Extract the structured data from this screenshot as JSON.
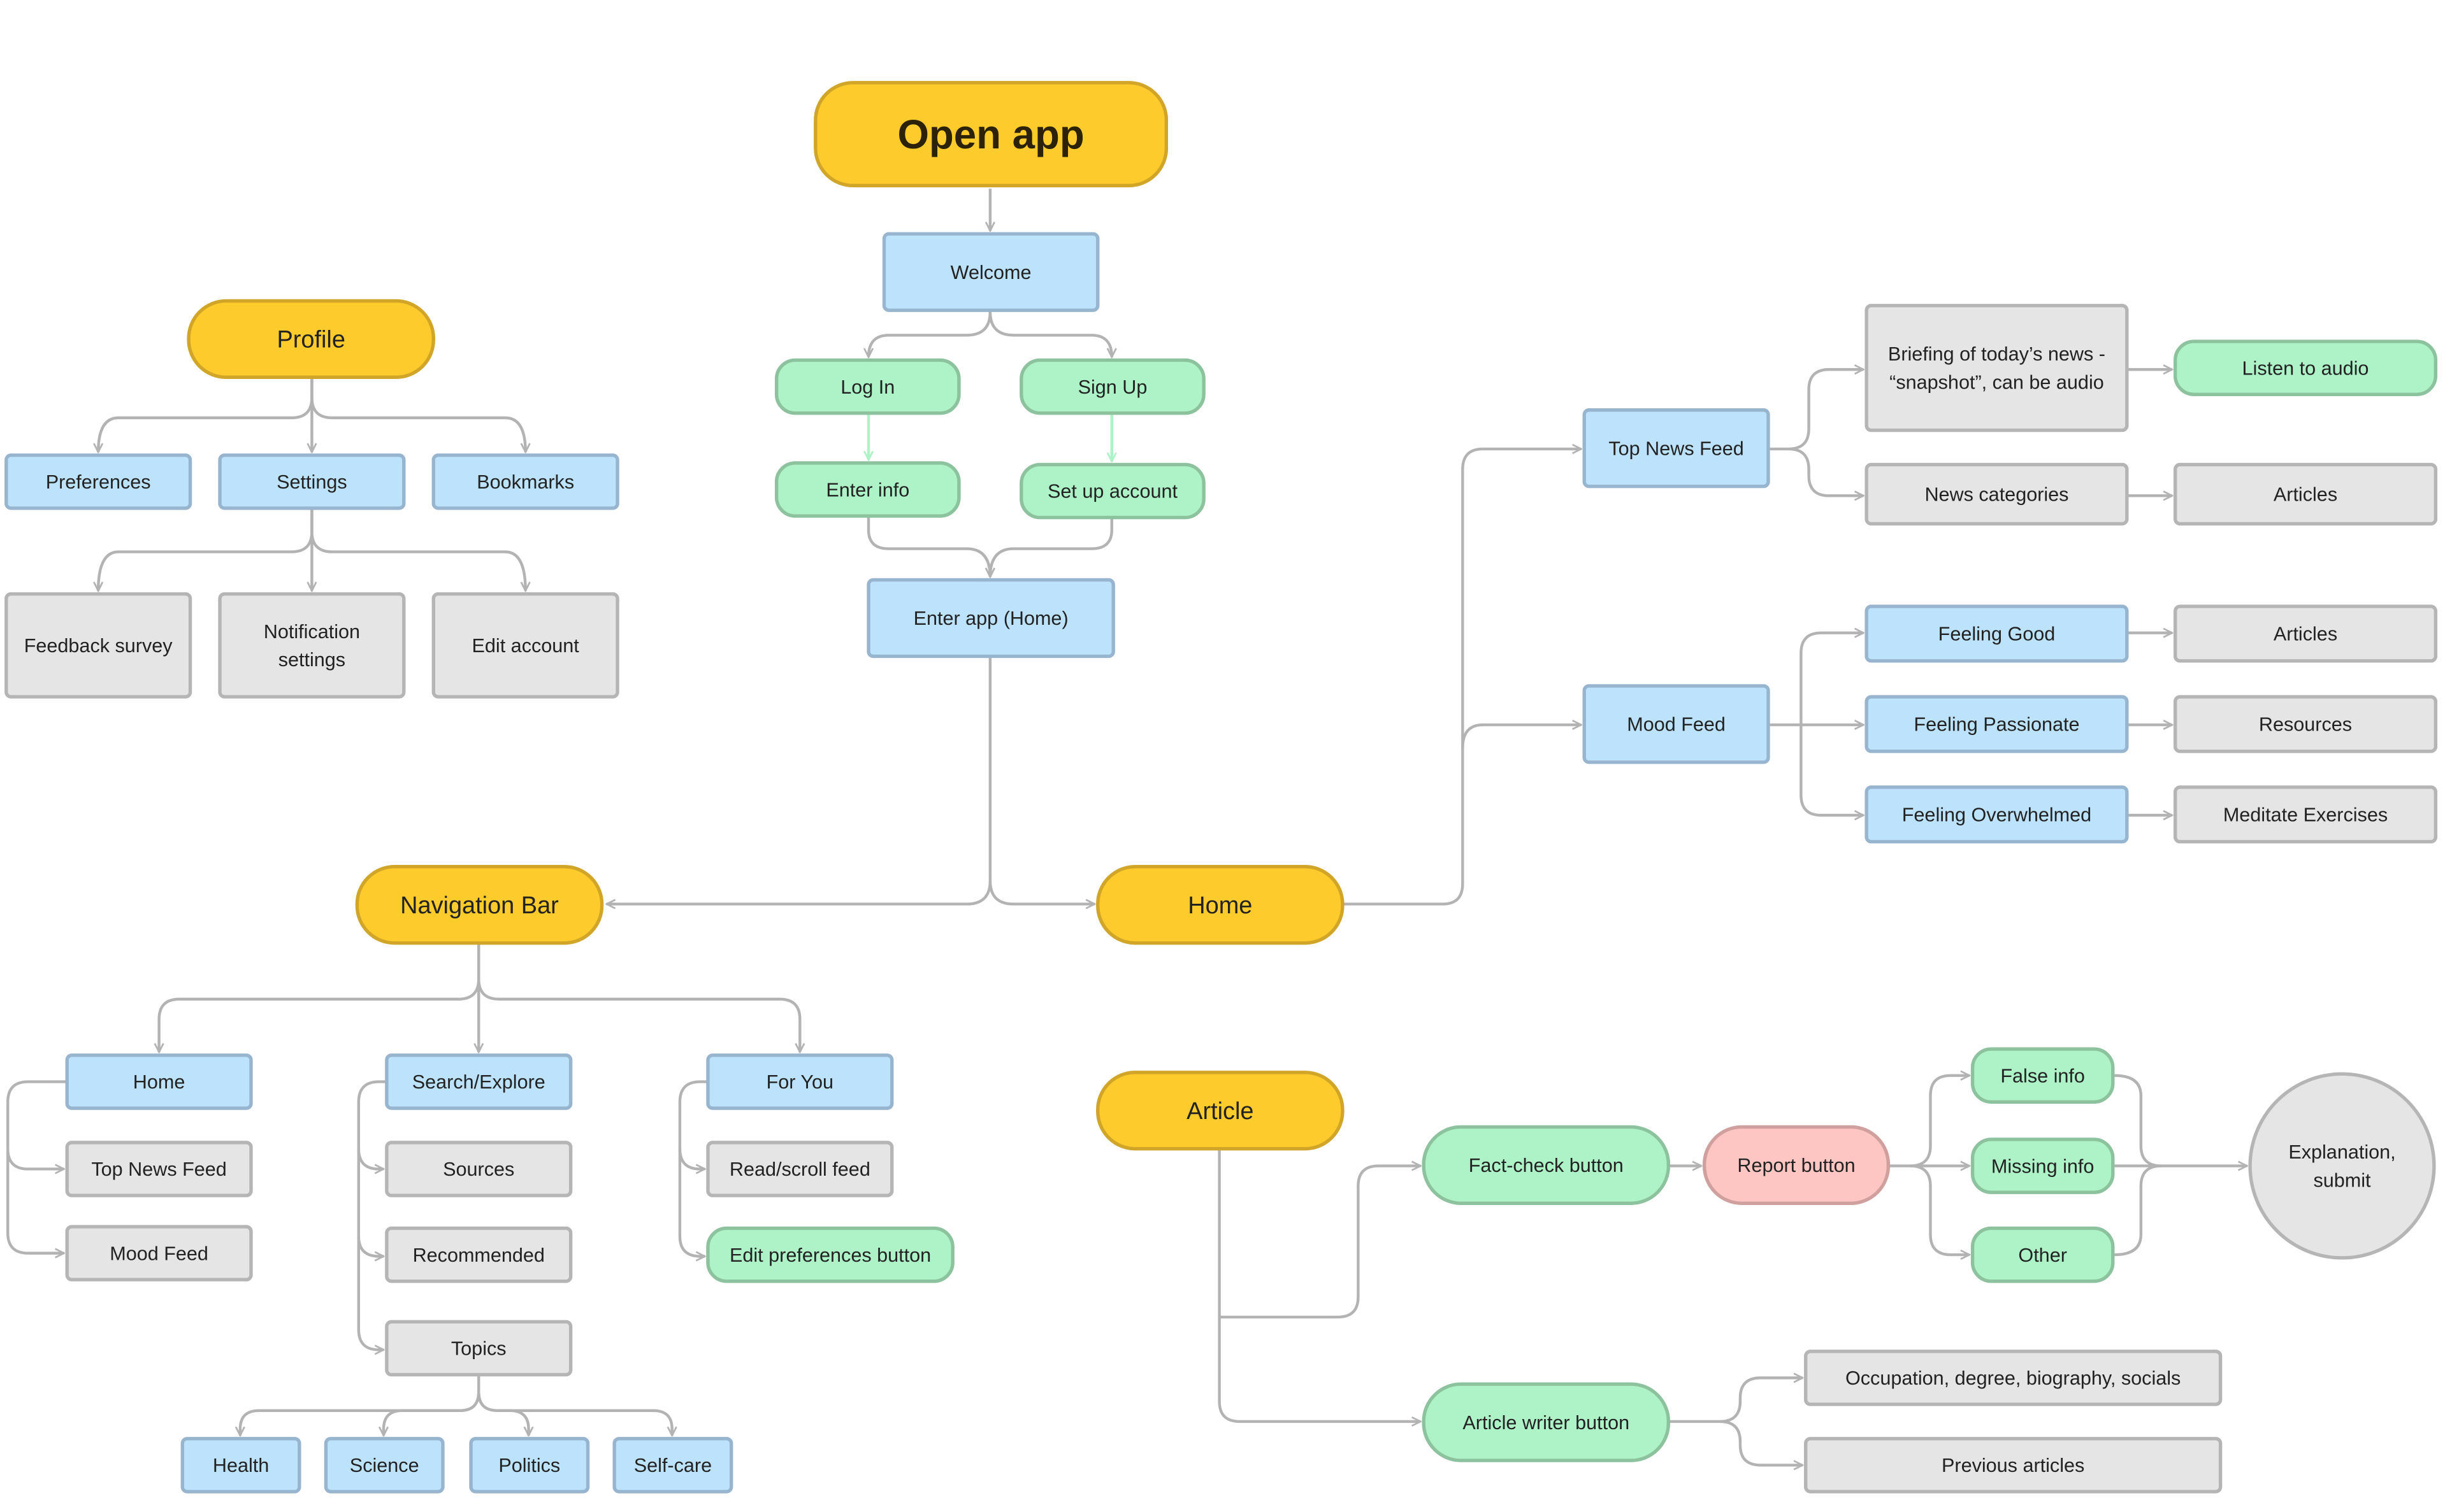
{
  "colors": {
    "start": {
      "fill": "#FDCB2B",
      "stroke": "#D1A528"
    },
    "screen": {
      "fill": "#BDE3FC",
      "stroke": "#97B5CE"
    },
    "action": {
      "fill": "#AEF3C7",
      "stroke": "#8CC29D"
    },
    "content": {
      "fill": "#E5E5E5",
      "stroke": "#B5B5B5"
    },
    "report": {
      "fill": "#FDC6C3",
      "stroke": "#CFA09D"
    },
    "connector": "#B3B3B3"
  },
  "nodes": {
    "open_app": "Open app",
    "welcome": "Welcome",
    "log_in": "Log In",
    "sign_up": "Sign Up",
    "enter_info": "Enter info",
    "set_up_account": "Set up account",
    "enter_app": "Enter app (Home)",
    "profile": "Profile",
    "preferences": "Preferences",
    "settings": "Settings",
    "bookmarks": "Bookmarks",
    "feedback_survey": "Feedback survey",
    "notification_settings": [
      "Notification",
      "settings"
    ],
    "edit_account": "Edit account",
    "navigation_bar": "Navigation Bar",
    "home": "Home",
    "article": "Article",
    "top_news_feed": "Top News Feed",
    "mood_feed": "Mood Feed",
    "briefing": [
      "Briefing of today’s news -",
      "“snapshot”, can be audio"
    ],
    "news_categories": "News categories",
    "listen_to_audio": "Listen to audio",
    "articles_news": "Articles",
    "feeling_good": "Feeling Good",
    "feeling_passionate": "Feeling Passionate",
    "feeling_overwhelmed": "Feeling Overwhelmed",
    "articles_mood": "Articles",
    "resources": "Resources",
    "meditate_exercises": "Meditate Exercises",
    "nav_home": "Home",
    "nav_top_news_feed": "Top News Feed",
    "nav_mood_feed": "Mood Feed",
    "search_explore": "Search/Explore",
    "sources": "Sources",
    "recommended": "Recommended",
    "topics": "Topics",
    "for_you": "For You",
    "read_scroll_feed": "Read/scroll feed",
    "edit_preferences_button": "Edit preferences button",
    "health": "Health",
    "science": "Science",
    "politics": "Politics",
    "self_care": "Self-care",
    "fact_check_button": "Fact-check button",
    "report_button": "Report button",
    "false_info": "False info",
    "missing_info": "Missing info",
    "other": "Other",
    "explanation_submit": [
      "Explanation,",
      "submit"
    ],
    "article_writer_button": "Article writer button",
    "occupation": "Occupation, degree, biography, socials",
    "previous_articles": "Previous articles"
  }
}
